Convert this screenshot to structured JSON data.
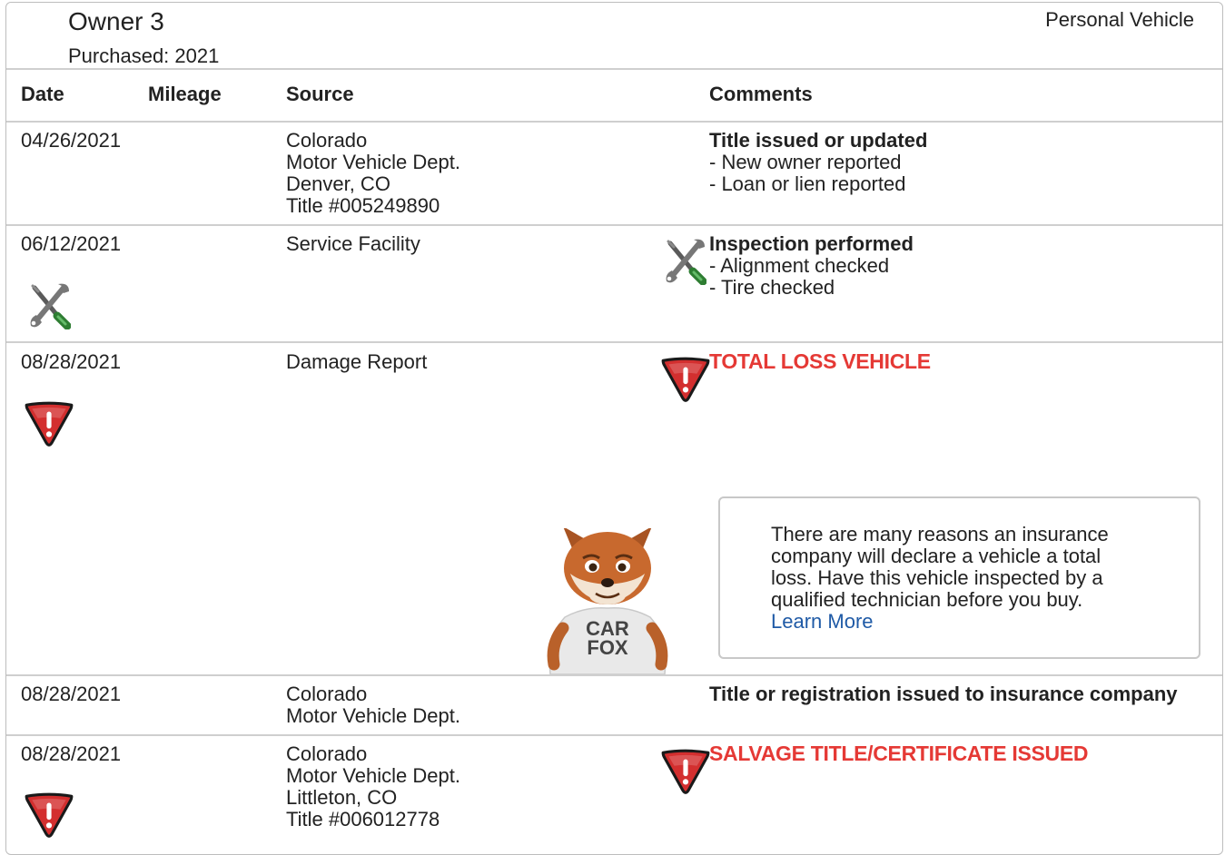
{
  "owner": {
    "title": "Owner 3",
    "purchased": "Purchased: 2021",
    "vehicle_type": "Personal Vehicle"
  },
  "columns": {
    "date": "Date",
    "mileage": "Mileage",
    "source": "Source",
    "comments": "Comments"
  },
  "rows": [
    {
      "date": "04/26/2021",
      "source": [
        "Colorado",
        "Motor Vehicle Dept.",
        "Denver, CO",
        "Title #005249890"
      ],
      "comment_title": "Title issued or updated",
      "comment_items": [
        "- New owner reported",
        "- Loan or lien reported"
      ]
    },
    {
      "date": "06/12/2021",
      "source": [
        "Service Facility"
      ],
      "icon": "wrench-screwdriver-icon",
      "comment_title": "Inspection performed",
      "comment_items": [
        "- Alignment checked",
        "- Tire checked"
      ]
    },
    {
      "date": "08/28/2021",
      "source": [
        "Damage Report"
      ],
      "icon": "warning-triangle-icon",
      "alert": "TOTAL LOSS VEHICLE"
    },
    {
      "date": "08/28/2021",
      "source": [
        "Colorado",
        "Motor Vehicle Dept."
      ],
      "comment_title": "Title or registration issued to insurance company"
    },
    {
      "date": "08/28/2021",
      "source": [
        "Colorado",
        "Motor Vehicle Dept.",
        "Littleton, CO",
        "Title #006012778"
      ],
      "icon": "warning-triangle-icon",
      "alert": "SALVAGE TITLE/CERTIFICATE ISSUED"
    }
  ],
  "callout": {
    "lines": [
      "There are many reasons an insurance",
      "company will declare a vehicle a total",
      "loss. Have this vehicle inspected by a",
      "qualified technician before you buy."
    ],
    "link": "Learn More"
  },
  "mascot": {
    "shirt_text": [
      "CAR",
      "FOX"
    ]
  },
  "colors": {
    "alert_red": "#e53935",
    "link_blue": "#1f5aa6",
    "divider": "#cfcfcf"
  }
}
